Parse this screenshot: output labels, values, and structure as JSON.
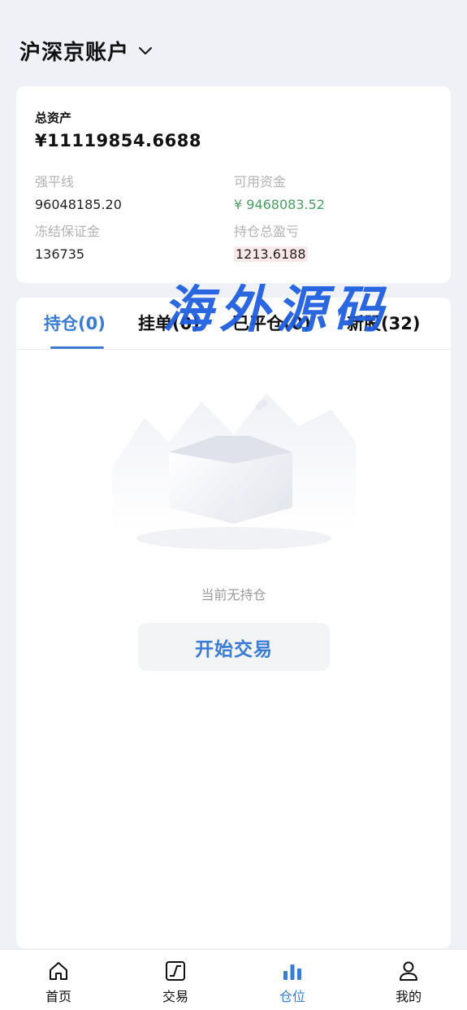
{
  "header": {
    "title": "沪深京账户",
    "dropdown_icon": "chevron-down-icon"
  },
  "summary": {
    "total_label": "总资产",
    "total_value": "¥11119854.6688",
    "items": [
      {
        "label": "强平线",
        "value": "96048185.20"
      },
      {
        "label": "可用资金",
        "value": "¥ 9468083.52"
      },
      {
        "label": "冻结保证金",
        "value": "136735"
      },
      {
        "label": "持仓总盈亏",
        "value": "1213.6188"
      }
    ],
    "colors": {
      "available_funds": "#4a9e62",
      "pnl_highlight": "#fbe8ea"
    }
  },
  "watermark": "海外源码",
  "tabs": [
    {
      "label": "持仓(0)",
      "active": true
    },
    {
      "label": "挂单(0)",
      "active": false
    },
    {
      "label": "已平仓(0)",
      "active": false
    },
    {
      "label": "新股(32)",
      "active": false
    }
  ],
  "empty": {
    "icon": "empty-box-illustration",
    "text": "当前无持仓",
    "button_label": "开始交易"
  },
  "bottom_nav": [
    {
      "label": "首页",
      "icon": "home-icon",
      "active": false
    },
    {
      "label": "交易",
      "icon": "chart-trend-icon",
      "active": false
    },
    {
      "label": "仓位",
      "icon": "bar-chart-icon",
      "active": true
    },
    {
      "label": "我的",
      "icon": "user-icon",
      "active": false
    }
  ],
  "accent_color": "#3a7bd5"
}
